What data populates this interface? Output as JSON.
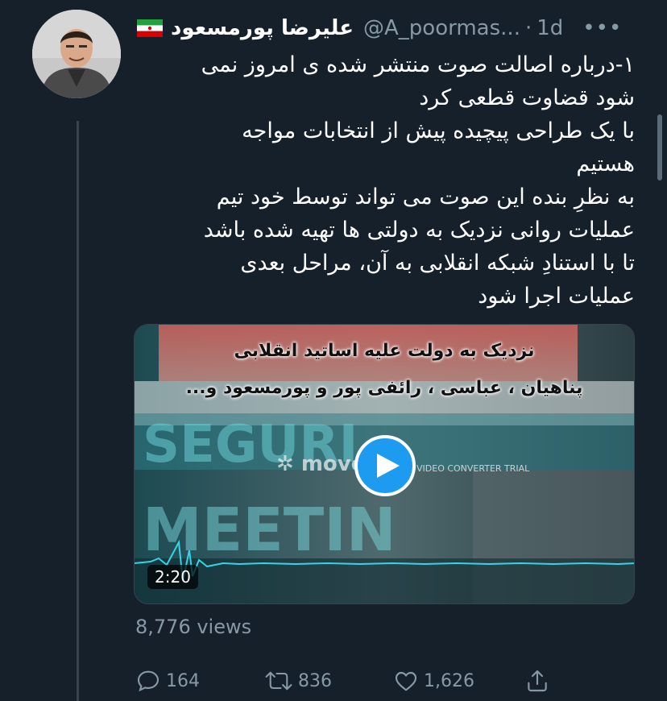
{
  "author": {
    "display_name": "علیرضا پورمسعود",
    "handle": "@A_poormas...",
    "separator": "·",
    "time": "1d",
    "flag_icon": "iran-flag-icon"
  },
  "more_icon": "•••",
  "tweet": {
    "lines": [
      "۱-درباره اصالت صوت منتشر شده ی امروز نمی",
      "شود قضاوت قطعی کرد",
      "با یک طراحی پیچیده پیش از انتخابات مواجه",
      "هستیم",
      "به نظرِ بنده این صوت می تواند توسط خود تیم",
      "عملیات روانی نزدیک به دولتی ها تهیه شده باشد",
      "تا با استنادِ شبکه انقلابی به آن، مراحل بعدی",
      "عملیات اجرا شود"
    ]
  },
  "media": {
    "caption_lines": [
      "نزدیک به دولت علیه اساتید انقلابی",
      "پناهیان ، عباسی ، رائفی پور و پورمسعود و..."
    ],
    "watermark": "movo",
    "watermark_trial": "VIDEO CONVERTER TRIAL",
    "duration": "2:20"
  },
  "views": "8,776 views",
  "actions": {
    "reply_count": "164",
    "retweet_count": "836",
    "like_count": "1,626"
  },
  "colors": {
    "background": "#15202b",
    "secondary_text": "#8899a6",
    "accent": "#1d9bf0",
    "divider": "#38444d"
  }
}
